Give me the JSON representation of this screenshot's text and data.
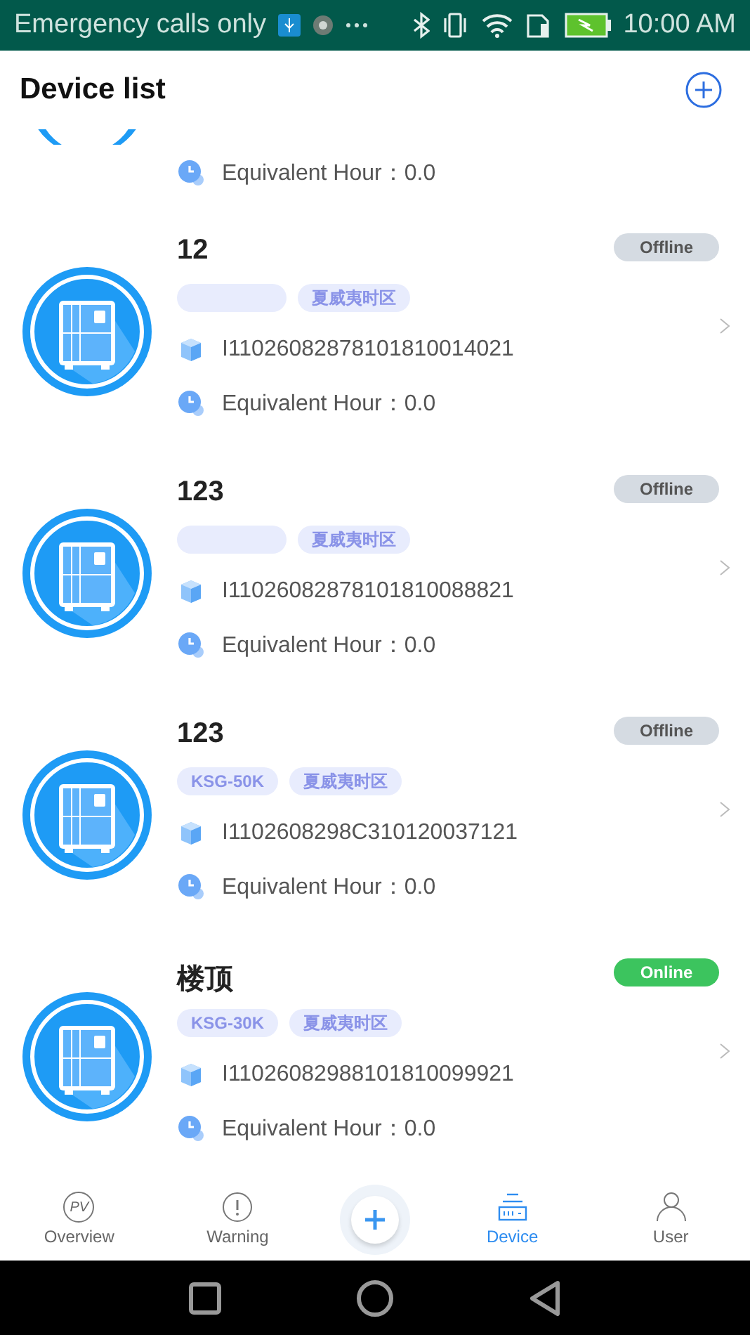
{
  "status_bar": {
    "carrier": "Emergency calls only",
    "time": "10:00 AM"
  },
  "header": {
    "title": "Device list"
  },
  "devices": [
    {
      "kind": "partial",
      "hours_label": "Equivalent Hour：",
      "hours": "0.0"
    },
    {
      "kind": "full",
      "name": "12",
      "online": false,
      "status": "Offline",
      "tags": [
        {
          "kind": "blank"
        },
        {
          "kind": "text",
          "label": "夏威夷时区"
        }
      ],
      "serial": "I11026082878101810014021",
      "hours_label": "Equivalent Hour：",
      "hours": "0.0"
    },
    {
      "kind": "full",
      "name": "123",
      "online": false,
      "status": "Offline",
      "tags": [
        {
          "kind": "blank"
        },
        {
          "kind": "text",
          "label": "夏威夷时区"
        }
      ],
      "serial": "I11026082878101810088821",
      "hours_label": "Equivalent Hour：",
      "hours": "0.0"
    },
    {
      "kind": "full",
      "name": "123",
      "online": false,
      "status": "Offline",
      "tags": [
        {
          "kind": "text",
          "label": "KSG-50K"
        },
        {
          "kind": "text",
          "label": "夏威夷时区"
        }
      ],
      "serial": "I1102608298C310120037121",
      "hours_label": "Equivalent Hour：",
      "hours": "0.0"
    },
    {
      "kind": "full",
      "name": "楼顶",
      "online": true,
      "status": "Online",
      "tags": [
        {
          "kind": "text",
          "label": "KSG-30K"
        },
        {
          "kind": "text",
          "label": "夏威夷时区"
        }
      ],
      "serial": "I11026082988101810099921",
      "hours_label": "Equivalent Hour：",
      "hours": "0.0"
    }
  ],
  "tabs": [
    {
      "kind": "overview",
      "label": "Overview",
      "icon_text": "PV",
      "selected": false
    },
    {
      "kind": "warning",
      "label": "Warning",
      "selected": false
    },
    {
      "kind": "add"
    },
    {
      "kind": "device",
      "label": "Device",
      "selected": true
    },
    {
      "kind": "user",
      "label": "User",
      "selected": false
    }
  ]
}
